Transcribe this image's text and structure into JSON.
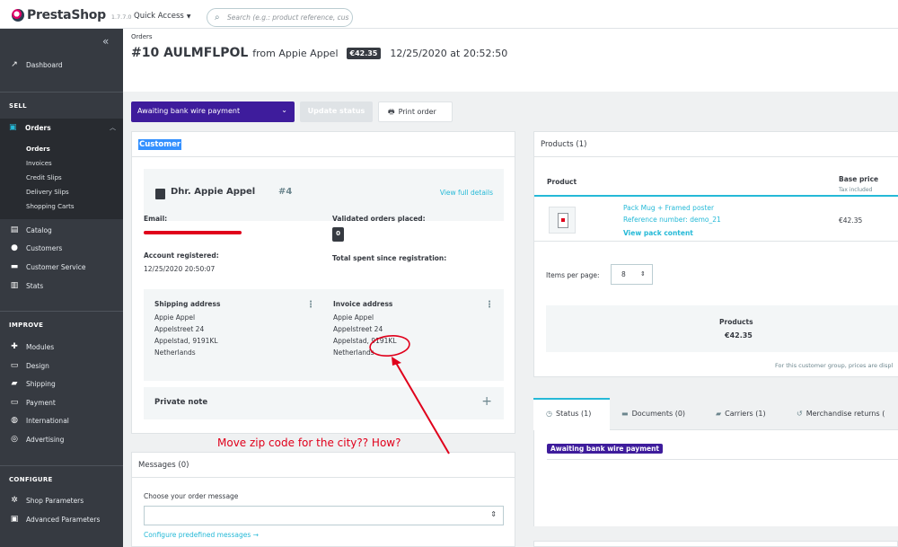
{
  "header": {
    "brand": "PrestaShop",
    "version": "1.7.7.0",
    "quick_access": "Quick Access",
    "search_placeholder": "Search (e.g.: product reference, custome"
  },
  "sidebar": {
    "dashboard": "Dashboard",
    "sell": "SELL",
    "orders": "Orders",
    "orders_sub": [
      "Orders",
      "Invoices",
      "Credit Slips",
      "Delivery Slips",
      "Shopping Carts"
    ],
    "catalog": "Catalog",
    "customers": "Customers",
    "customer_service": "Customer Service",
    "stats": "Stats",
    "improve": "IMPROVE",
    "modules": "Modules",
    "design": "Design",
    "shipping": "Shipping",
    "payment": "Payment",
    "international": "International",
    "advertising": "Advertising",
    "configure": "CONFIGURE",
    "shop_parameters": "Shop Parameters",
    "advanced_parameters": "Advanced Parameters"
  },
  "page": {
    "breadcrumb": "Orders",
    "order_number": "#10 AULMFLPOL",
    "from": "from Appie Appel",
    "total": "€42.35",
    "date": "12/25/2020 at 20:52:50"
  },
  "toolbar": {
    "status_select": "Awaiting bank wire payment",
    "update_status": "Update status",
    "print_order": "Print order"
  },
  "customer": {
    "heading": "Customer",
    "name": "Dhr. Appie Appel",
    "id": "#4",
    "view_full": "View full details",
    "email_label": "Email:",
    "validated_label": "Validated orders placed:",
    "validated_count": "0",
    "registered_label": "Account registered:",
    "registered_value": "12/25/2020 20:50:07",
    "total_spent_label": "Total spent since registration:",
    "shipping_heading": "Shipping address",
    "shipping_lines": [
      "Appie Appel",
      "Appelstreet 24",
      "Appelstad, 9191KL",
      "Netherlands"
    ],
    "invoice_heading": "Invoice address",
    "invoice_lines": [
      "Appie Appel",
      "Appelstreet 24",
      "Appelstad, 9191KL",
      "Netherlands"
    ],
    "private_note": "Private note"
  },
  "messages": {
    "heading": "Messages (0)",
    "choose_label": "Choose your order message",
    "configure_link": "Configure predefined messages →"
  },
  "products": {
    "heading": "Products (1)",
    "col_product": "Product",
    "col_base_price": "Base price",
    "col_base_price_sub": "Tax included",
    "row_name": "Pack Mug + Framed poster",
    "row_reference": "Reference number: demo_21",
    "row_view": "View pack content",
    "row_price": "€42.35",
    "items_per_page_label": "Items per page:",
    "items_per_page_value": "8",
    "totals_label": "Products",
    "totals_value": "€42.35",
    "group_note": "For this customer group, prices are displ"
  },
  "tabs": {
    "status": "Status (1)",
    "documents": "Documents (0)",
    "carriers": "Carriers (1)",
    "returns": "Merchandise returns (",
    "current_status": "Awaiting bank wire payment"
  },
  "annotation": {
    "text": "Move zip code for the city?? How?",
    "color": "#e0001b"
  },
  "colors": {
    "sidebar": "#363a41",
    "accent": "#25b9d7",
    "status_purple": "#3e1c9c"
  }
}
